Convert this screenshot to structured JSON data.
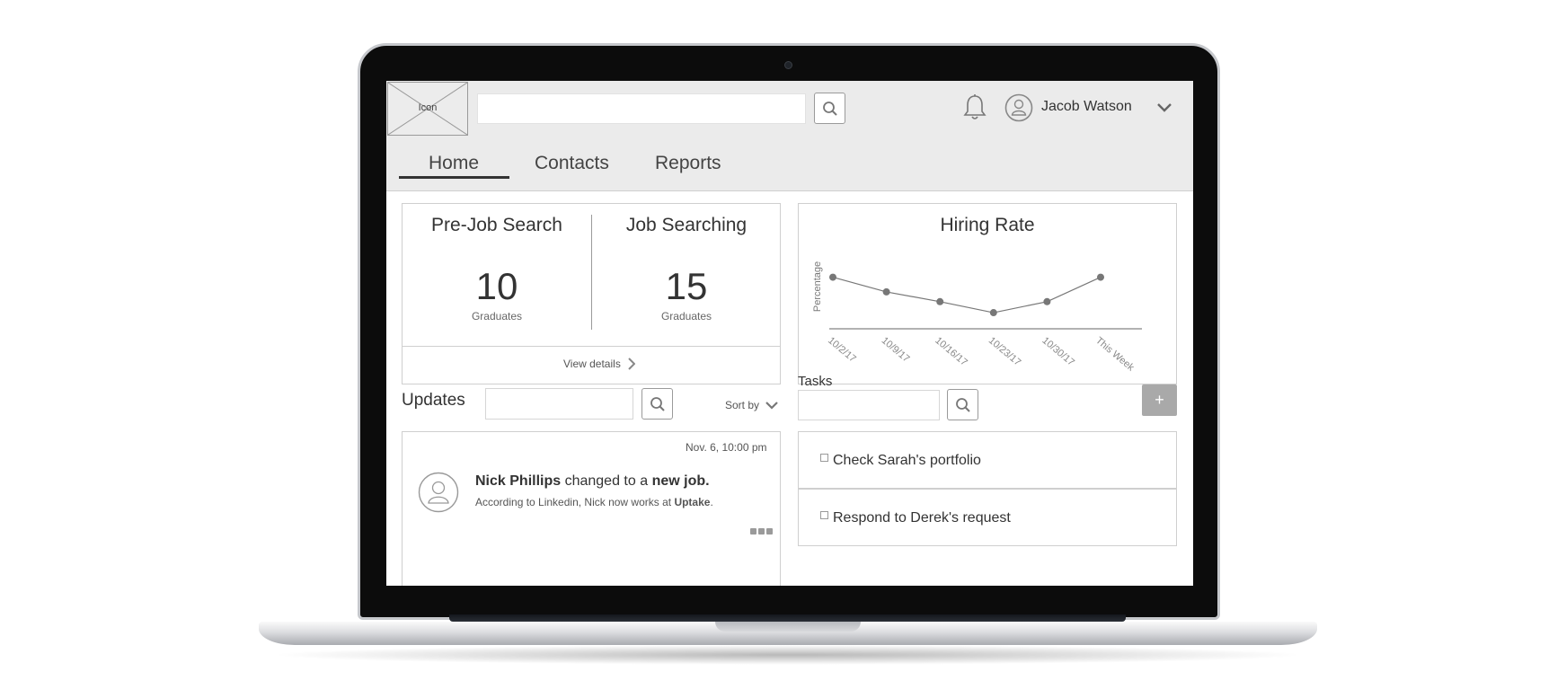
{
  "header": {
    "logo_label": "Icon",
    "search_value": "",
    "user_name": "Jacob Watson"
  },
  "nav": {
    "tabs": [
      {
        "label": "Home",
        "active": true
      },
      {
        "label": "Contacts",
        "active": false
      },
      {
        "label": "Reports",
        "active": false
      }
    ]
  },
  "stats": {
    "pre_job": {
      "title": "Pre-Job Search",
      "value": "10",
      "unit": "Graduates"
    },
    "job_searching": {
      "title": "Job Searching",
      "value": "15",
      "unit": "Graduates"
    },
    "view_details": "View details"
  },
  "chart_data": {
    "type": "line",
    "title": "Hiring Rate",
    "ylabel": "Percentage",
    "xlabel": "",
    "categories": [
      "10/2/17",
      "10/9/17",
      "10/16/17",
      "10/23/17",
      "10/30/17",
      "This Week"
    ],
    "values": [
      40,
      28,
      20,
      11,
      20,
      40
    ],
    "ylim": [
      0,
      100
    ],
    "grid": false
  },
  "updates": {
    "title": "Updates",
    "search_value": "",
    "sort_label": "Sort by",
    "items": [
      {
        "time": "Nov. 6,  10:00 pm",
        "actor": "Nick Phillips",
        "action": " changed to a ",
        "object": "new job.",
        "detail_prefix": "According to Linkedin, Nick now works at ",
        "detail_company": "Uptake",
        "detail_suffix": "."
      }
    ]
  },
  "tasks": {
    "title": "Tasks",
    "search_value": "",
    "add_label": "+",
    "items": [
      {
        "label": "Check Sarah's portfolio",
        "checked": false
      },
      {
        "label": "Respond to Derek's request",
        "checked": false
      }
    ]
  },
  "colors": {
    "header_bg": "#ebebeb",
    "border": "#cfcfcf",
    "line": "#777777",
    "button_gray": "#a9a9a9"
  }
}
